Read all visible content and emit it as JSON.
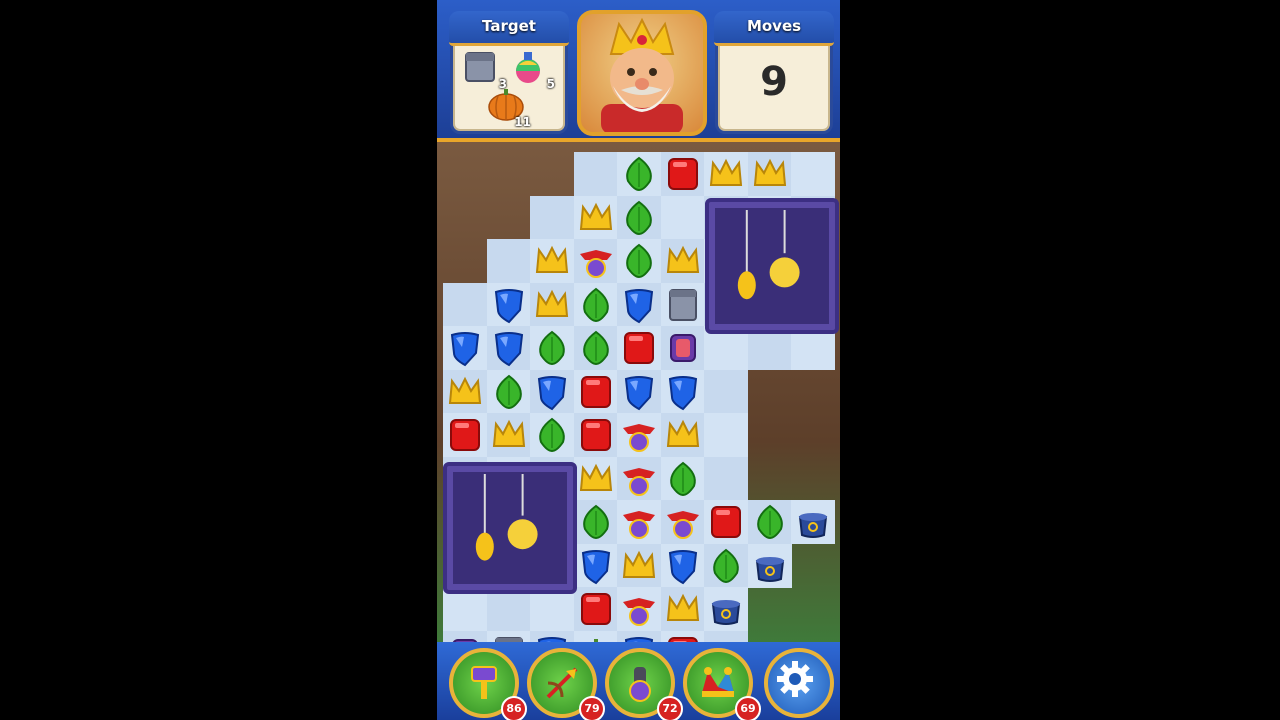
{
  "hud": {
    "target_title": "Target",
    "moves_title": "Moves",
    "moves_value": "9",
    "targets": [
      {
        "icon": "pipe-icon",
        "count": "3"
      },
      {
        "icon": "rainbow-potion-icon",
        "count": "5"
      },
      {
        "icon": "pumpkin-icon",
        "count": "11"
      }
    ]
  },
  "boosters": [
    {
      "name": "royal-hammer",
      "count": "86"
    },
    {
      "name": "arrow",
      "count": "79"
    },
    {
      "name": "cannon",
      "count": "72"
    },
    {
      "name": "jester-hat",
      "count": "69"
    }
  ],
  "colors": {
    "red": "#e01818",
    "blue": "#1f63e6",
    "green": "#39b52a",
    "yellow": "#f5c21a"
  }
}
